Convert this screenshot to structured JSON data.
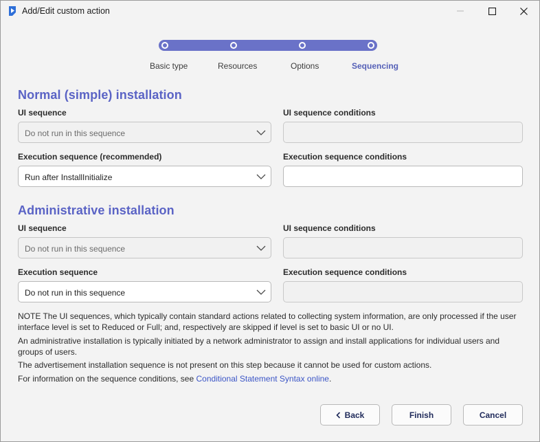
{
  "window": {
    "title": "Add/Edit custom action"
  },
  "stepper": {
    "steps": [
      "Basic type",
      "Resources",
      "Options",
      "Sequencing"
    ],
    "active": 3
  },
  "normal": {
    "title": "Normal (simple) installation",
    "ui_label": "UI sequence",
    "ui_value": "Do not run in this sequence",
    "ui_cond_label": "UI sequence conditions",
    "ui_cond_value": "",
    "exec_label": "Execution sequence (recommended)",
    "exec_value": "Run after InstallInitialize",
    "exec_cond_label": "Execution sequence conditions",
    "exec_cond_value": ""
  },
  "admin": {
    "title": "Administrative installation",
    "ui_label": "UI sequence",
    "ui_value": "Do not run in this sequence",
    "ui_cond_label": "UI sequence conditions",
    "ui_cond_value": "",
    "exec_label": "Execution sequence",
    "exec_value": "Do not run in this sequence",
    "exec_cond_label": "Execution sequence conditions",
    "exec_cond_value": ""
  },
  "notes": {
    "note1": "NOTE The UI sequences, which typically contain standard actions related to collecting system information, are only processed if the user interface level is set to Reduced or Full; and, respectively are skipped if level is set to basic UI or no UI.",
    "note2": "An administrative installation is typically initiated by a network administrator to assign and install applications for individual users and groups of users.",
    "note3": "The advertisement installation sequence is not present on this step because it cannot be used for custom actions.",
    "note4_prefix": "For information on the sequence conditions, see ",
    "note4_link": "Conditional Statement Syntax online",
    "note4_suffix": "."
  },
  "buttons": {
    "back": "Back",
    "finish": "Finish",
    "cancel": "Cancel"
  },
  "colors": {
    "accent": "#5a63c5",
    "stepper": "#6a72c8",
    "link": "#3b55c6"
  }
}
